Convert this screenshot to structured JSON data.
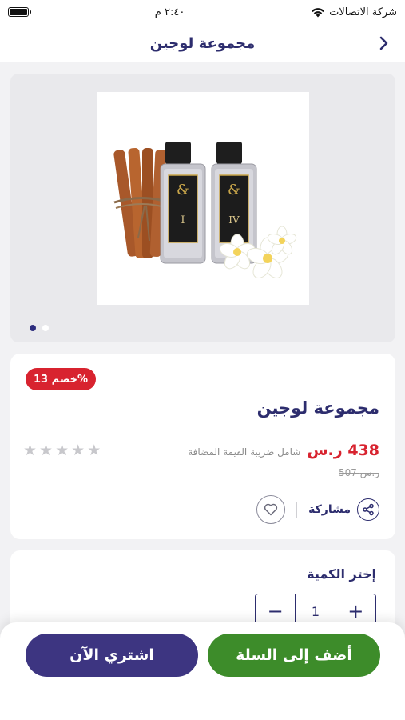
{
  "status_bar": {
    "time": "٢:٤٠ م",
    "carrier": "شركة الاتصالات"
  },
  "nav": {
    "title": "مجموعة لوجين"
  },
  "gallery": {
    "slide_count": 2,
    "active_slide": 1,
    "bottle_labels": [
      "I",
      "IV"
    ]
  },
  "product": {
    "discount_badge": "خصم 13%",
    "title": "مجموعة لوجين",
    "price": "438 ر.س",
    "tax_note": "شامل ضريبة القيمة المضافة",
    "old_price": "507 ر.س",
    "rating": 0,
    "max_rating": 5,
    "share_label": "مشاركة"
  },
  "quantity": {
    "label": "إختر الكمية",
    "value": "1",
    "minus": "−",
    "plus": "+"
  },
  "bottom_bar": {
    "add_to_cart_label": "أضف إلى السلة",
    "buy_now_label": "اشتري الآن"
  },
  "colors": {
    "brand": "#2d2d6e",
    "buy_button": "#3d3581",
    "cart_button": "#3d8c2a",
    "discount": "#d8232f"
  }
}
